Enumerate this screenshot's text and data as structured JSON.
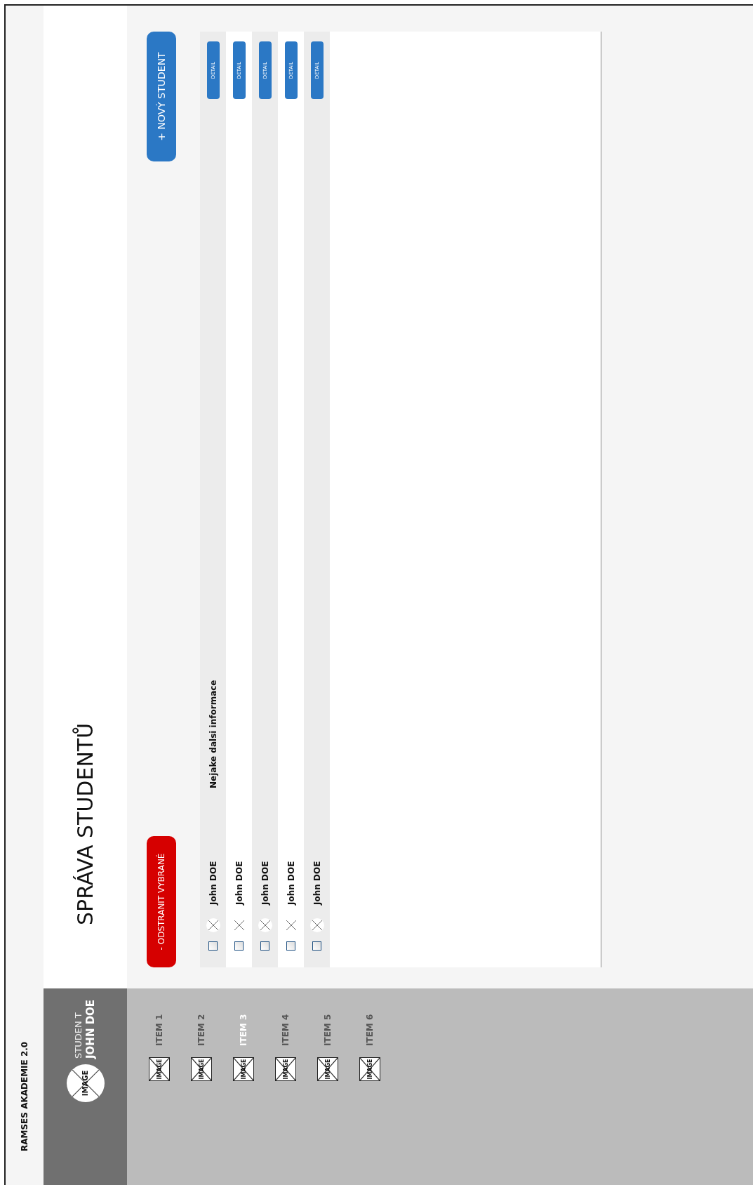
{
  "app": {
    "title": "RAMSES AKADEMIE 2.0"
  },
  "user": {
    "avatar_label": "IMAGE",
    "role": "STUDEN T",
    "name": "JOHN DOE"
  },
  "sidebar": {
    "items": [
      {
        "label": "ITEM 1",
        "icon_label": "IMAGE",
        "selected": false
      },
      {
        "label": "ITEM 2",
        "icon_label": "IMAGE",
        "selected": false
      },
      {
        "label": "ITEM 3",
        "icon_label": "IMAGE",
        "selected": true
      },
      {
        "label": "ITEM 4",
        "icon_label": "IMAGE",
        "selected": false
      },
      {
        "label": "ITEM 5",
        "icon_label": "IMAGE",
        "selected": false
      },
      {
        "label": "ITEM 6",
        "icon_label": "IMAGE",
        "selected": false
      }
    ]
  },
  "page": {
    "title": "SPRÁVA STUDENTŮ"
  },
  "actions": {
    "remove": "- ODSTRANIT VYBRANÉ",
    "add": "+ NOVÝ STUDENT"
  },
  "students": [
    {
      "name": "John DOE",
      "info": "Nejake dalsi informace",
      "checked": false,
      "detail": "DETAIL"
    },
    {
      "name": "John DOE",
      "checked": false,
      "detail": "DETAIL"
    },
    {
      "name": "John DOE",
      "checked": false,
      "detail": "DETAIL"
    },
    {
      "name": "John DOE",
      "checked": false,
      "detail": "DETAIL"
    },
    {
      "name": "John DOE",
      "checked": false,
      "detail": "DETAIL"
    }
  ]
}
